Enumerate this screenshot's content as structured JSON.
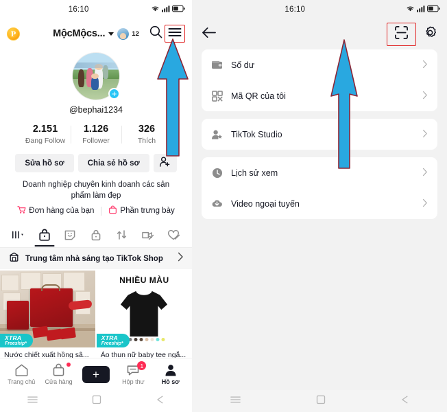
{
  "left_phone": {
    "status_bar": {
      "time": "16:10",
      "wifi_icon": "wifi-icon",
      "signal_icon": "signal-bars-icon",
      "battery_icon": "battery-icon"
    },
    "header": {
      "coin_label": "P",
      "username": "MộcMộcs...",
      "dropdown_icon": "chevron-down-icon",
      "friends_count": "12",
      "search_icon": "search-icon",
      "menu_icon": "hamburger-menu-icon"
    },
    "profile": {
      "avatar_name": "profile-avatar",
      "add_icon": "plus-badge-icon",
      "handle": "@bephai1234",
      "stats": [
        {
          "value": "2.151",
          "label": "Đang Follow"
        },
        {
          "value": "1.126",
          "label": "Follower"
        },
        {
          "value": "326",
          "label": "Thích"
        }
      ],
      "buttons": {
        "edit_profile": "Sửa hồ sơ",
        "share_profile": "Chia sẻ hồ sơ",
        "add_friend_icon": "add-person-icon"
      },
      "bio": "Doanh nghiệp chuyên kinh doanh các sản phẩm làm đẹp",
      "biz_links": [
        {
          "icon": "shopping-cart-icon",
          "label": "Đơn hàng của bạn"
        },
        {
          "icon": "handbag-icon",
          "label": "Phần trưng bày"
        }
      ]
    },
    "tabs": [
      {
        "icon": "grid-sort-icon",
        "active": false
      },
      {
        "icon": "shopping-bag-icon",
        "active": true
      },
      {
        "icon": "sticker-smiley-icon",
        "active": false
      },
      {
        "icon": "lock-icon",
        "active": false
      },
      {
        "icon": "repost-arrows-icon",
        "active": false
      },
      {
        "icon": "video-off-icon",
        "active": false
      },
      {
        "icon": "heart-off-icon",
        "active": false
      }
    ],
    "creator_row": {
      "icon": "store-icon",
      "label": "Trung tâm nhà sáng tạo TikTok Shop",
      "chevron": "chevron-right-icon"
    },
    "products": [
      {
        "title": "Nước chiết xuất hồng sâ...",
        "badge_line1": "XTRA",
        "badge_line2": "Freeship*",
        "overlay_title": ""
      },
      {
        "title": "Áo thun nữ baby tee ngắ...",
        "badge_line1": "XTRA",
        "badge_line2": "Freeship*",
        "overlay_title": "NHIỀU MÀU"
      }
    ],
    "bottom_nav": [
      {
        "icon": "home-icon",
        "label": "Trang chủ",
        "active": false,
        "badge": ""
      },
      {
        "icon": "shop-bag-icon",
        "label": "Cửa hàng",
        "active": false,
        "badge": "dot"
      },
      {
        "icon": "plus-create-icon",
        "label": "",
        "active": false,
        "badge": ""
      },
      {
        "icon": "inbox-message-icon",
        "label": "Hộp thư",
        "active": false,
        "badge": "1"
      },
      {
        "icon": "profile-person-icon",
        "label": "Hồ sơ",
        "active": true,
        "badge": ""
      }
    ],
    "android_nav": {
      "recents_icon": "recents-icon",
      "home_icon": "home-square-icon",
      "back_icon": "back-triangle-icon"
    }
  },
  "right_phone": {
    "status_bar": {
      "time": "16:10",
      "wifi_icon": "wifi-icon",
      "signal_icon": "signal-bars-icon",
      "battery_icon": "battery-icon"
    },
    "header": {
      "back_icon": "back-arrow-icon",
      "scan_icon": "qr-scan-icon",
      "settings_icon": "gear-icon"
    },
    "cards": [
      {
        "rows": [
          {
            "icon": "wallet-icon",
            "label": "Số dư",
            "chevron": "chevron-right-icon"
          },
          {
            "icon": "qr-code-icon",
            "label": "Mã QR của tôi",
            "chevron": "chevron-right-icon"
          }
        ]
      },
      {
        "rows": [
          {
            "icon": "creator-star-icon",
            "label": "TikTok Studio",
            "chevron": "chevron-right-icon"
          }
        ]
      },
      {
        "rows": [
          {
            "icon": "clock-history-icon",
            "label": "Lịch sử xem",
            "chevron": "chevron-right-icon"
          },
          {
            "icon": "download-cloud-icon",
            "label": "Video ngoại tuyến",
            "chevron": "chevron-right-icon"
          }
        ]
      }
    ],
    "android_nav": {
      "recents_icon": "recents-icon",
      "home_icon": "home-square-icon",
      "back_icon": "back-triangle-icon"
    }
  },
  "annotations": {
    "arrow_color": "#29A8E0",
    "arrow_outline_color": "#8B2535",
    "highlight_box_color": "#E02424",
    "left_arrow_target": "hamburger-menu-icon",
    "right_arrow_target": "qr-scan-icon"
  }
}
